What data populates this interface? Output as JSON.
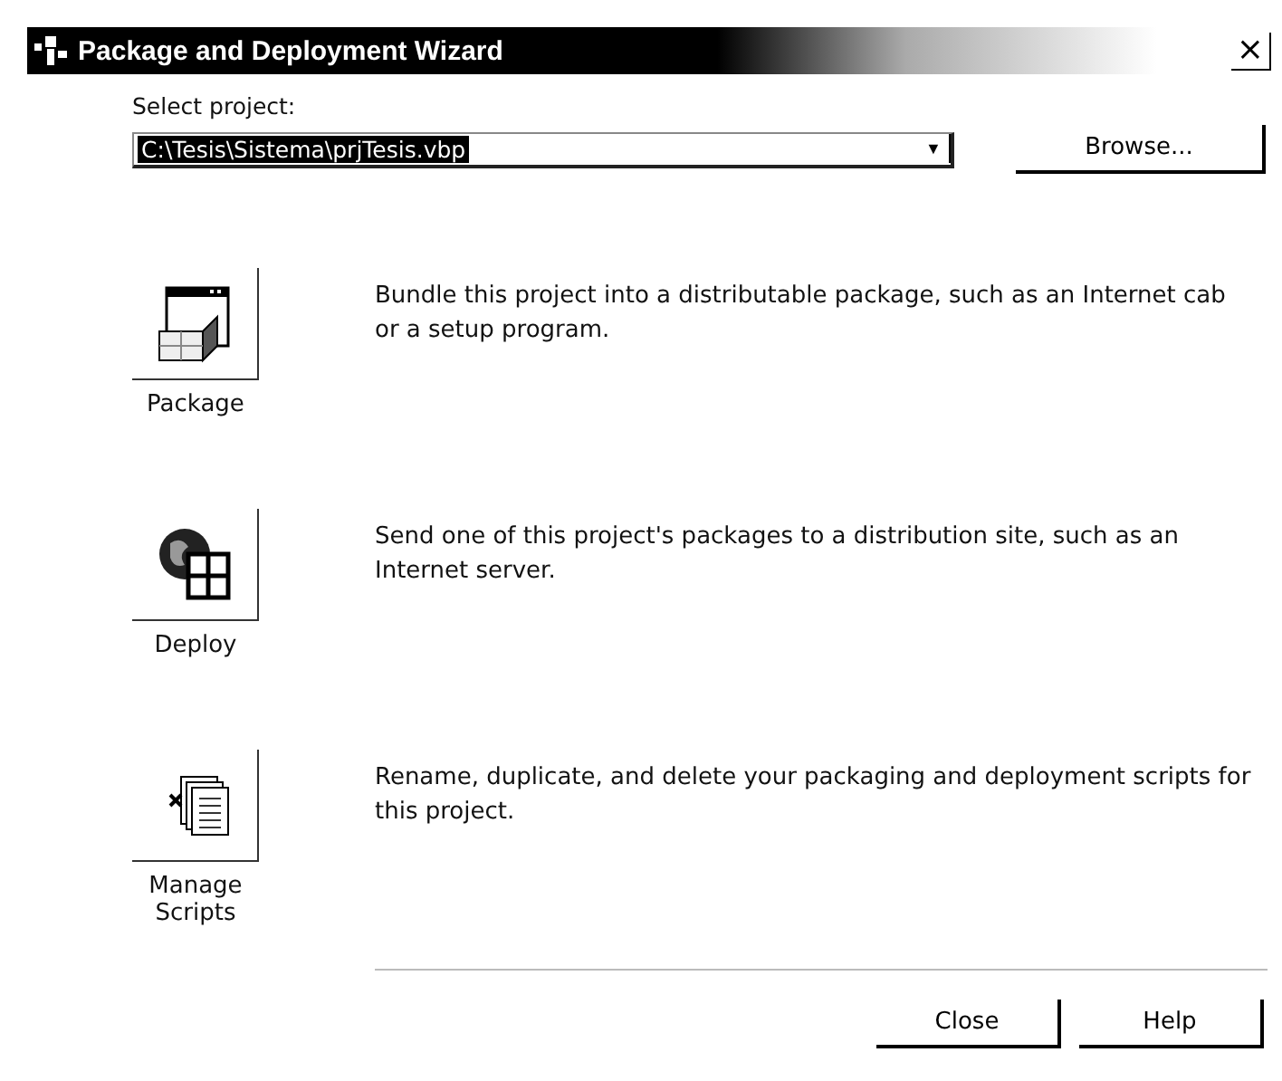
{
  "window": {
    "title": "Package and Deployment Wizard",
    "close": "×"
  },
  "project": {
    "label": "Select project:",
    "value": "C:\\Tesis\\Sistema\\prjTesis.vbp",
    "dropdown": "▼",
    "browse": "Browse..."
  },
  "actions": [
    {
      "kind": "package",
      "label": "Package",
      "description": "Bundle this project into a distributable package, such as an Internet cab or a setup program."
    },
    {
      "kind": "deploy",
      "label": "Deploy",
      "description": "Send one of this project's packages to a distribution site, such as an Internet server."
    },
    {
      "kind": "scripts",
      "label": "Manage Scripts",
      "description": "Rename, duplicate, and delete your packaging and deployment scripts for this project."
    }
  ],
  "buttons": [
    "Close",
    "Help"
  ]
}
